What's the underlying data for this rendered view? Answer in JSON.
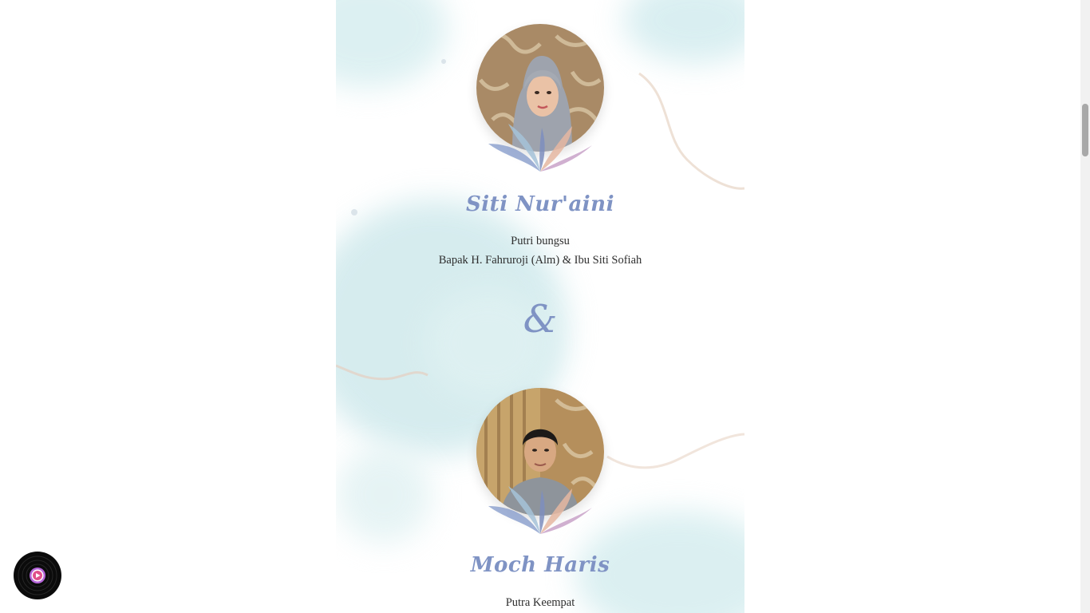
{
  "bride": {
    "name": "Siti Nur'aini",
    "relation": "Putri bungsu",
    "parents": "Bapak H. Fahruroji (Alm) & Ibu Siti Sofiah"
  },
  "ampersand": "&",
  "groom": {
    "name": "Moch Haris",
    "relation": "Putra Keempat"
  },
  "music_button": {
    "icon": "vinyl-record-icon"
  },
  "colors": {
    "accent": "#7f93c4",
    "watercolor": "#cfe9ec",
    "body_text": "#2e2e2e"
  }
}
